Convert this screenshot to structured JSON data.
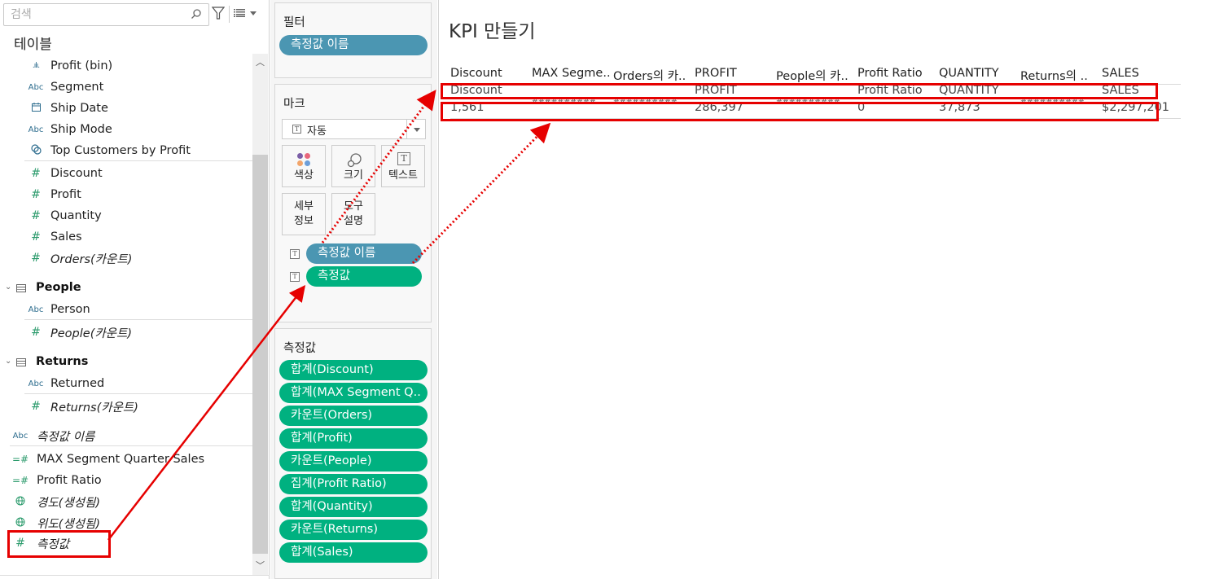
{
  "data_pane": {
    "search_placeholder": "검색",
    "section_title": "테이블",
    "fields": [
      {
        "icon": "bin-icon",
        "glyph": ".ılı.",
        "label": "Profit (bin)",
        "italic": false,
        "type": "dim"
      },
      {
        "icon": "abc-icon",
        "glyph": "Abc",
        "label": "Segment",
        "italic": false,
        "type": "dim"
      },
      {
        "icon": "calendar-icon",
        "glyph": "📅",
        "label": "Ship Date",
        "italic": false,
        "type": "dim"
      },
      {
        "icon": "abc-icon",
        "glyph": "Abc",
        "label": "Ship Mode",
        "italic": false,
        "type": "dim"
      },
      {
        "icon": "set-icon",
        "glyph": "⊘",
        "label": "Top Customers by Profit",
        "italic": false,
        "type": "dim"
      },
      {
        "icon": "number-icon",
        "glyph": "#",
        "label": "Discount",
        "italic": false,
        "type": "mea"
      },
      {
        "icon": "number-icon",
        "glyph": "#",
        "label": "Profit",
        "italic": false,
        "type": "mea"
      },
      {
        "icon": "number-icon",
        "glyph": "#",
        "label": "Quantity",
        "italic": false,
        "type": "mea"
      },
      {
        "icon": "number-icon",
        "glyph": "#",
        "label": "Sales",
        "italic": false,
        "type": "mea"
      },
      {
        "icon": "number-icon",
        "glyph": "#",
        "label": "Orders(카운트)",
        "italic": true,
        "type": "mea"
      }
    ],
    "groups": [
      {
        "label": "People",
        "fields": [
          {
            "icon": "abc-icon",
            "glyph": "Abc",
            "label": "Person",
            "italic": false
          },
          {
            "icon": "number-icon",
            "glyph": "#",
            "label": "People(카운트)",
            "italic": true
          }
        ]
      },
      {
        "label": "Returns",
        "fields": [
          {
            "icon": "abc-icon",
            "glyph": "Abc",
            "label": "Returned",
            "italic": false
          },
          {
            "icon": "number-icon",
            "glyph": "#",
            "label": "Returns(카운트)",
            "italic": true
          }
        ]
      }
    ],
    "extra_fields": [
      {
        "icon": "abc-icon",
        "glyph": "Abc",
        "label": "측정값 이름",
        "italic": true
      },
      {
        "icon": "calc-number-icon",
        "glyph": "=#",
        "label": "MAX Segment Quarter Sales",
        "italic": false
      },
      {
        "icon": "calc-number-icon",
        "glyph": "=#",
        "label": "Profit Ratio",
        "italic": false
      },
      {
        "icon": "globe-icon",
        "glyph": "⊕",
        "label": "경도(생성됨)",
        "italic": true
      },
      {
        "icon": "globe-icon",
        "glyph": "⊕",
        "label": "위도(생성됨)",
        "italic": true
      },
      {
        "icon": "number-icon",
        "glyph": "#",
        "label": "측정값",
        "italic": true
      }
    ]
  },
  "shelves": {
    "filter": {
      "title": "필터",
      "pills": [
        "측정값 이름"
      ]
    },
    "marks": {
      "title": "마크",
      "mark_type": "자동",
      "buttons": {
        "color": "색상",
        "size": "크기",
        "text": "텍스트",
        "detail_1": "세부",
        "detail_2": "정보",
        "tooltip_1": "도구",
        "tooltip_2": "설명"
      },
      "pills": [
        {
          "label": "측정값 이름",
          "kind": "dim"
        },
        {
          "label": "측정값",
          "kind": "mea"
        }
      ]
    },
    "measure_values": {
      "title": "측정값",
      "pills": [
        "합계(Discount)",
        "합계(MAX Segment Q..",
        "카운트(Orders)",
        "합계(Profit)",
        "카운트(People)",
        "집계(Profit Ratio)",
        "합계(Quantity)",
        "카운트(Returns)",
        "합계(Sales)"
      ]
    }
  },
  "view": {
    "title": "KPI 만들기",
    "columns": [
      {
        "header": "Discount",
        "name_row": "Discount",
        "value": "1,561",
        "hash": false
      },
      {
        "header": "MAX Segme..",
        "name_row": "",
        "value": "",
        "hash": true
      },
      {
        "header": "Orders의 카..",
        "name_row": "",
        "value": "",
        "hash": true
      },
      {
        "header": "PROFIT",
        "name_row": "PROFIT",
        "value": "286,397",
        "hash": false
      },
      {
        "header": "People의 카..",
        "name_row": "",
        "value": "",
        "hash": true
      },
      {
        "header": "Profit Ratio",
        "name_row": "Profit Ratio",
        "value": "0",
        "hash": false
      },
      {
        "header": "QUANTITY",
        "name_row": "QUANTITY",
        "value": "37,873",
        "hash": false
      },
      {
        "header": "Returns의 ..",
        "name_row": "",
        "value": "",
        "hash": true
      },
      {
        "header": "SALES",
        "name_row": "SALES",
        "value": "$2,297,201",
        "hash": false
      }
    ],
    "hash_text": "##########"
  },
  "colors": {
    "dimension_pill": "#4b96b2",
    "measure_pill": "#00b180",
    "annotation": "#e60000",
    "number_icon": "#2a9a6b"
  }
}
